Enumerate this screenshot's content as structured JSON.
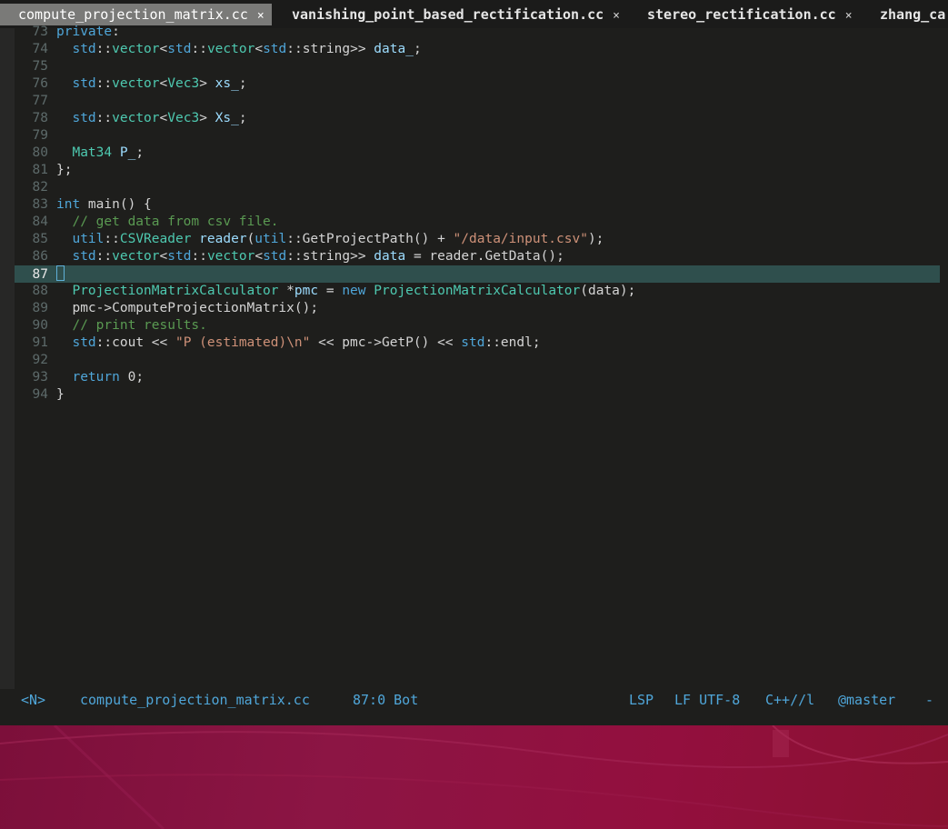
{
  "tabs": [
    {
      "label": "compute_projection_matrix.cc",
      "close": "×",
      "active": true
    },
    {
      "label": "vanishing_point_based_rectification.cc",
      "close": "×",
      "active": false
    },
    {
      "label": "stereo_rectification.cc",
      "close": "×",
      "active": false
    },
    {
      "label": "zhang_ca",
      "close": "",
      "active": false
    }
  ],
  "editor": {
    "current_line": "87",
    "lines": [
      {
        "n": "73",
        "parts": [
          [
            " ",
            ""
          ],
          [
            "k",
            "private"
          ],
          [
            "",
            ""
          ],
          [
            "",
            ":"
          ]
        ]
      },
      {
        "n": "74",
        "parts": [
          [
            "",
            "  "
          ],
          [
            "k",
            "std"
          ],
          [
            "",
            "::"
          ],
          [
            "t",
            "vector"
          ],
          [
            "",
            "<"
          ],
          [
            "k",
            "std"
          ],
          [
            "",
            "::"
          ],
          [
            "t",
            "vector"
          ],
          [
            "",
            "<"
          ],
          [
            "k",
            "std"
          ],
          [
            "",
            "::string>> "
          ],
          [
            "v",
            "data_"
          ],
          [
            "",
            ";"
          ]
        ]
      },
      {
        "n": "75",
        "parts": []
      },
      {
        "n": "76",
        "parts": [
          [
            "",
            "  "
          ],
          [
            "k",
            "std"
          ],
          [
            "",
            "::"
          ],
          [
            "t",
            "vector"
          ],
          [
            "",
            "<"
          ],
          [
            "t",
            "Vec3"
          ],
          [
            "",
            "> "
          ],
          [
            "v",
            "xs_"
          ],
          [
            "",
            ";"
          ]
        ]
      },
      {
        "n": "77",
        "parts": []
      },
      {
        "n": "78",
        "parts": [
          [
            "",
            "  "
          ],
          [
            "k",
            "std"
          ],
          [
            "",
            "::"
          ],
          [
            "t",
            "vector"
          ],
          [
            "",
            "<"
          ],
          [
            "t",
            "Vec3"
          ],
          [
            "",
            "> "
          ],
          [
            "v",
            "Xs_"
          ],
          [
            "",
            ";"
          ]
        ]
      },
      {
        "n": "79",
        "parts": []
      },
      {
        "n": "80",
        "parts": [
          [
            "",
            "  "
          ],
          [
            "t",
            "Mat34"
          ],
          [
            "",
            " "
          ],
          [
            "v",
            "P_"
          ],
          [
            "",
            ";"
          ]
        ]
      },
      {
        "n": "81",
        "parts": [
          [
            "",
            "};"
          ]
        ]
      },
      {
        "n": "82",
        "parts": []
      },
      {
        "n": "83",
        "parts": [
          [
            "k",
            "int"
          ],
          [
            "",
            " main() {"
          ]
        ]
      },
      {
        "n": "84",
        "parts": [
          [
            "",
            "  "
          ],
          [
            "c",
            "// get data from csv file."
          ]
        ]
      },
      {
        "n": "85",
        "parts": [
          [
            "",
            "  "
          ],
          [
            "k",
            "util"
          ],
          [
            "",
            "::"
          ],
          [
            "t",
            "CSVReader"
          ],
          [
            "",
            " "
          ],
          [
            "v",
            "reader"
          ],
          [
            "",
            "("
          ],
          [
            "k",
            "util"
          ],
          [
            "",
            "::GetProjectPath() + "
          ],
          [
            "s",
            "\"/data/input.csv\""
          ],
          [
            "",
            ");"
          ]
        ]
      },
      {
        "n": "86",
        "parts": [
          [
            "",
            "  "
          ],
          [
            "k",
            "std"
          ],
          [
            "",
            "::"
          ],
          [
            "t",
            "vector"
          ],
          [
            "",
            "<"
          ],
          [
            "k",
            "std"
          ],
          [
            "",
            "::"
          ],
          [
            "t",
            "vector"
          ],
          [
            "",
            "<"
          ],
          [
            "k",
            "std"
          ],
          [
            "",
            "::string>> "
          ],
          [
            "v",
            "data"
          ],
          [
            "",
            " = reader.GetData();"
          ]
        ]
      },
      {
        "n": "87",
        "parts": []
      },
      {
        "n": "88",
        "parts": [
          [
            "",
            "  "
          ],
          [
            "t",
            "ProjectionMatrixCalculator"
          ],
          [
            "",
            " *"
          ],
          [
            "v",
            "pmc"
          ],
          [
            "",
            " = "
          ],
          [
            "k",
            "new"
          ],
          [
            "",
            " "
          ],
          [
            "t",
            "ProjectionMatrixCalculator"
          ],
          [
            "",
            "(data);"
          ]
        ]
      },
      {
        "n": "89",
        "parts": [
          [
            "",
            "  pmc->ComputeProjectionMatrix();"
          ]
        ]
      },
      {
        "n": "90",
        "parts": [
          [
            "",
            "  "
          ],
          [
            "c",
            "// print results."
          ]
        ]
      },
      {
        "n": "91",
        "parts": [
          [
            "",
            "  "
          ],
          [
            "k",
            "std"
          ],
          [
            "",
            "::cout << "
          ],
          [
            "s",
            "\"P (estimated)\\n\""
          ],
          [
            "",
            " << pmc->GetP() << "
          ],
          [
            "k",
            "std"
          ],
          [
            "",
            "::endl;"
          ]
        ]
      },
      {
        "n": "92",
        "parts": []
      },
      {
        "n": "93",
        "parts": [
          [
            "",
            "  "
          ],
          [
            "k",
            "return"
          ],
          [
            "",
            " 0;"
          ]
        ]
      },
      {
        "n": "94",
        "parts": [
          [
            "",
            "}"
          ]
        ]
      }
    ]
  },
  "status": {
    "mode": "<N>",
    "filename": "compute_projection_matrix.cc",
    "position": "87:0 Bot",
    "lsp": "LSP",
    "encoding": "LF UTF-8",
    "filetype": "C++//l",
    "branch": "@master",
    "trail": "-"
  }
}
